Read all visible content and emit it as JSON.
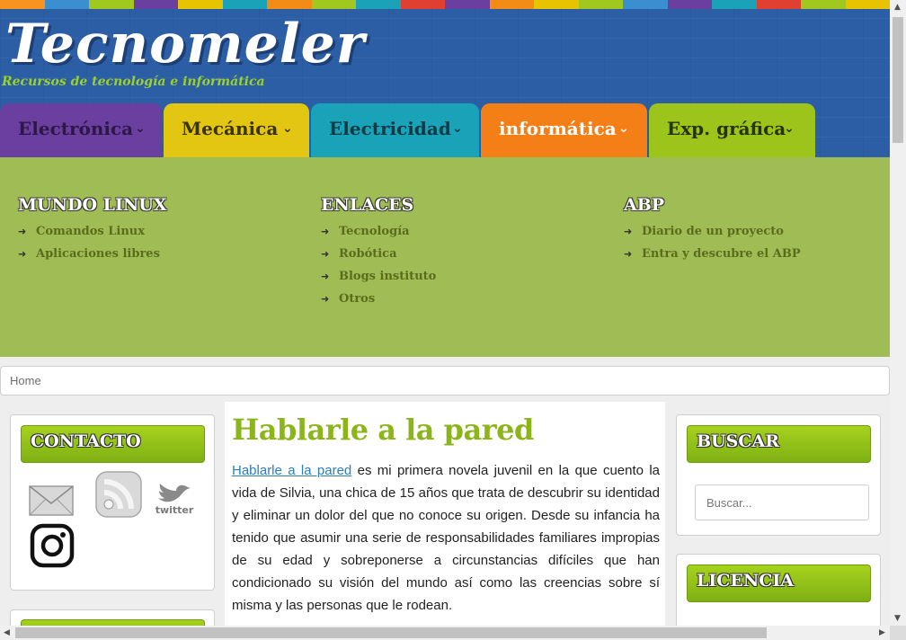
{
  "site": {
    "title": "Tecnomeler",
    "tagline": "Recursos de tecnología e informática"
  },
  "header_strip_colors": [
    "#f7931e",
    "#3a8fd0",
    "#a0c81e",
    "#6a3fa0",
    "#e8c400",
    "#1aa3b8",
    "#f28c16",
    "#a0c81e",
    "#1aa3b8",
    "#e04030",
    "#6a3fa0",
    "#f28c16",
    "#e8c400",
    "#a0c81e",
    "#3a8fd0",
    "#6a3fa0",
    "#1aa3b8",
    "#e04030",
    "#a0c81e",
    "#e8c400"
  ],
  "nav": {
    "tabs": [
      {
        "label": "Electrónica",
        "color": "#6a3fa0",
        "text_color": "#2d1746",
        "chevron": "chevron-down"
      },
      {
        "label": "Mecánica",
        "color": "#e2c612",
        "text_color": "#3b3300",
        "chevron": "chevron-down"
      },
      {
        "label": "Electricidad",
        "color": "#1aa3b8",
        "text_color": "#0f3a44",
        "chevron": "chevron-down"
      },
      {
        "label": "informática",
        "color": "#f47f16",
        "text_color": "#ffffff",
        "chevron": "chevron-down"
      },
      {
        "label": "Exp. gráfica",
        "color": "#9dc41b",
        "text_color": "#263300",
        "chevron": "chevron-down"
      }
    ]
  },
  "mega_menu": {
    "columns": [
      {
        "heading": "MUNDO LINUX",
        "links": [
          "Comandos Linux",
          "Aplicaciones libres"
        ]
      },
      {
        "heading": "ENLACES",
        "links": [
          "Tecnología",
          "Robótica",
          "Blogs instituto",
          "Otros"
        ]
      },
      {
        "heading": "ABP",
        "links": [
          "Diario de un proyecto",
          "Entra y descubre el ABP"
        ]
      }
    ]
  },
  "breadcrumb": {
    "home": "Home"
  },
  "left_sidebar": {
    "contacto_title": "CONTACTO",
    "icons": [
      "mail-icon",
      "rss-icon",
      "twitter-icon",
      "instagram-icon"
    ],
    "twitter_word": "twitter"
  },
  "post": {
    "title": "Hablarle a la pared",
    "link_text": "Hablarle a la pared",
    "body_rest": " es mi primera novela juvenil en la que cuento la vida de Silvia, una chica de 15 años que trata de descubrir su identidad y eliminar un dolor del que no conoce su origen. Desde su infancia ha tenido que asumir una serie de responsabilidades familiares impropias de su edad y sobreponerse a circunstancias difíciles que han condicionado su visión del mundo así como las creencias sobre sí misma y las personas que le rodean."
  },
  "right_sidebar": {
    "search_title": "BUSCAR",
    "search_placeholder": "Buscar...",
    "license_title": "LICENCIA"
  },
  "colors": {
    "header_bg": "#2c5ea6",
    "mega_bg": "#a0bd55",
    "accent_green": "#8bb51a",
    "link_blue": "#2a7fb8"
  }
}
